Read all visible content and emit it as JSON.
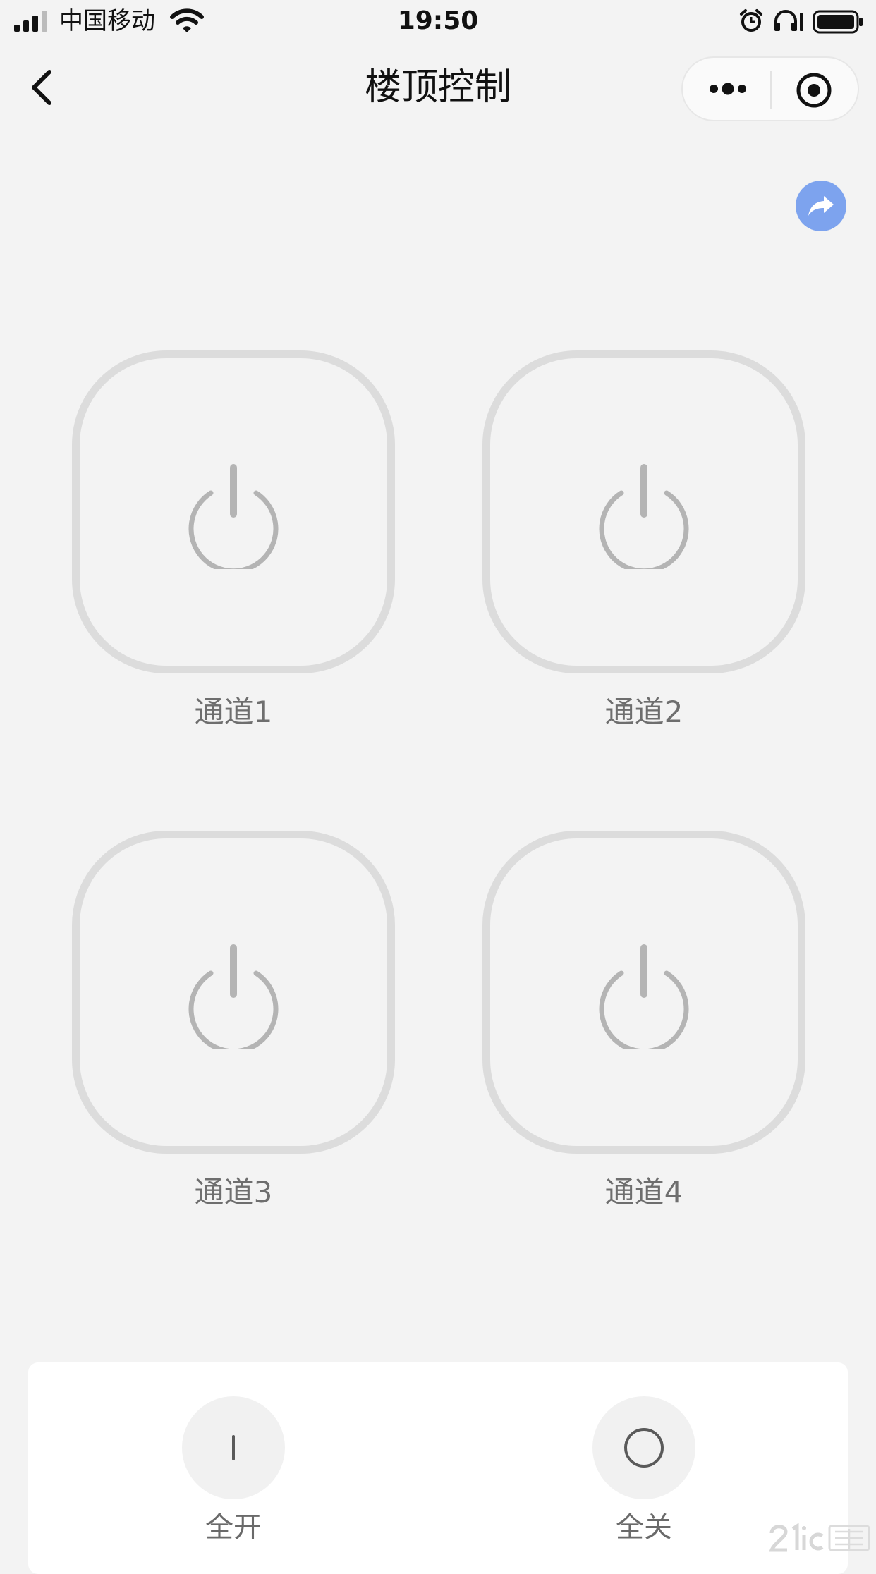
{
  "status_bar": {
    "carrier": "中国移动",
    "time": "19:50"
  },
  "nav": {
    "title": "楼顶控制",
    "more_icon": "more-dots-icon",
    "target_icon": "target-icon",
    "back_icon": "chevron-left-icon"
  },
  "share": {
    "icon": "share-arrow-icon",
    "color": "#7da3ee"
  },
  "channels": [
    {
      "label": "通道1"
    },
    {
      "label": "通道2"
    },
    {
      "label": "通道3"
    },
    {
      "label": "通道4"
    }
  ],
  "bottom_panel": {
    "all_on": {
      "label": "全开",
      "icon": "on-line-icon"
    },
    "all_off": {
      "label": "全关",
      "icon": "off-circle-icon"
    }
  },
  "colors": {
    "background": "#f3f3f3",
    "tile_border": "#dcdcdc",
    "power_icon": "#b4b4b4"
  },
  "watermark": {
    "brand_icon": "21ic-watermark-logo"
  }
}
